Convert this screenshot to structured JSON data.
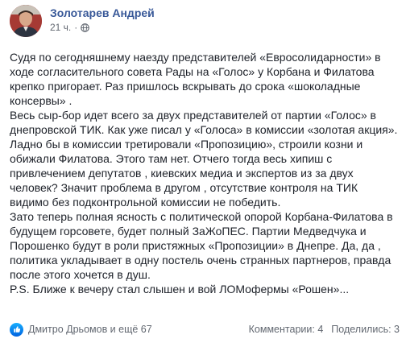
{
  "post": {
    "author": "Золотарев Андрей",
    "time": "21 ч.",
    "separator": "·",
    "globe_icon": "globe-icon",
    "paragraphs": [
      "Судя по сегодняшнему наезду представителей «Евросолидарности» в ходе согласительного совета Рады на «Голос» у Корбана и Филатова крепко пригорает. Раз пришлось вскрывать до срока «шоколадные консервы» .",
      "Весь сыр-бор идет всего за двух представителей от партии «Голос» в днепровской ТИК. Как уже писал у «Голоса» в комиссии «золотая акция». Ладно бы в комиссии третировали «Пропозицию», строили козни и обижали Филатова. Этого там нет. Отчего тогда весь хипиш с привлечением депутатов , киевских медиа и экспертов из за двух человек? Значит проблема в другом , отсутствие контроля на ТИК видимо без подконтрольной комиссии не победить.",
      "Зато теперь полная ясность с политической опорой Корбана-Филатова в будущем горсовете, будет полный ЗаЖоПЕС. Партии Медведчука и Порошенко будут в роли пристяжных «Пропозиции» в Днепре. Да, да , политика укладывает в одну постель очень странных партнеров, правда после этого хочется в душ.",
      "P.S. Ближе к вечеру стал слышен и вой ЛОМофермы «Рошен»..."
    ]
  },
  "footer": {
    "reactions_icon": "like-icon",
    "reactions_text": "Дмитро Дрьомов и ещё 67",
    "comments": "Комментарии: 4",
    "shares": "Поделились: 3"
  },
  "colors": {
    "author_link": "#385898",
    "meta_gray": "#616770",
    "like_blue": "#1877f2"
  }
}
